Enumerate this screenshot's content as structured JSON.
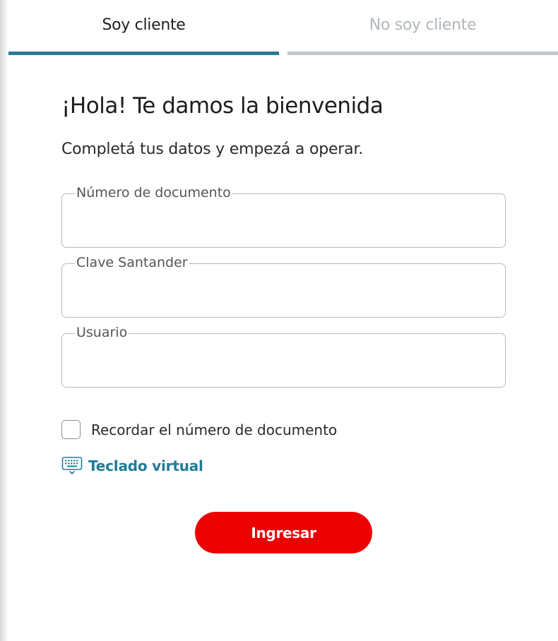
{
  "tabs": {
    "active_label": "Soy cliente",
    "inactive_label": "No soy cliente"
  },
  "header": {
    "title": "¡Hola! Te damos la bienvenida",
    "subtitle": "Completá tus datos y empezá a operar."
  },
  "form": {
    "document_label": "Número de documento",
    "document_value": "",
    "password_label": "Clave Santander",
    "password_value": "",
    "user_label": "Usuario",
    "user_value": "",
    "remember_label": "Recordar el número de documento",
    "remember_checked": false,
    "keyboard_label": "Teclado virtual",
    "keyboard_icon": "keyboard-icon",
    "submit_label": "Ingresar"
  },
  "colors": {
    "accent": "#2b7a94",
    "link": "#1f7c98",
    "primary_button": "#ec0000"
  }
}
